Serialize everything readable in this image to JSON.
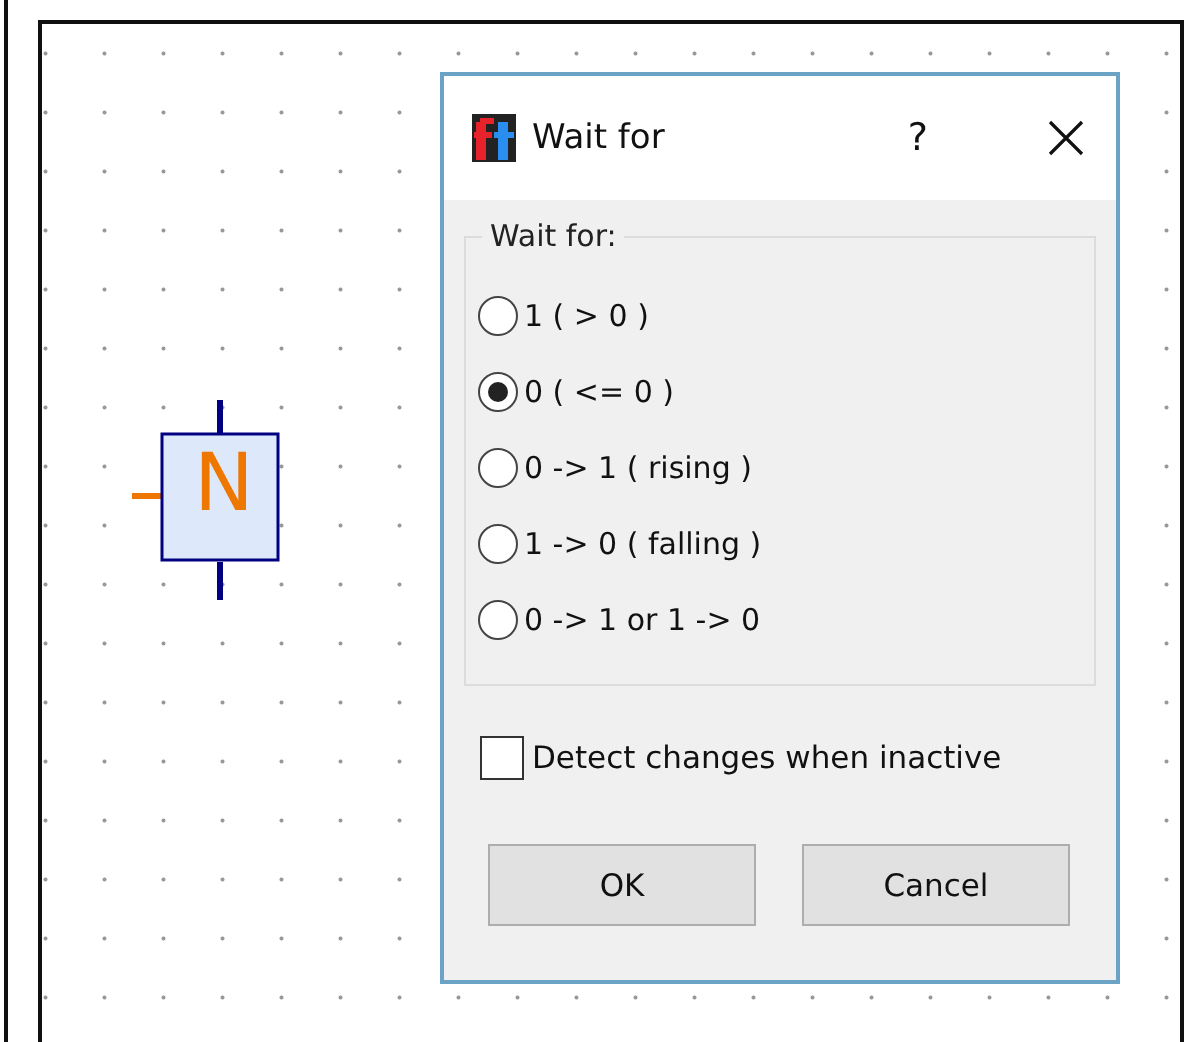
{
  "node": {
    "label": "N"
  },
  "dialog": {
    "title": "Wait for",
    "help": "?",
    "group": {
      "label": "Wait for:",
      "options": [
        {
          "label": "1 ( > 0 )",
          "selected": false
        },
        {
          "label": "0 ( <= 0 )",
          "selected": true
        },
        {
          "label": "0 -> 1 ( rising )",
          "selected": false
        },
        {
          "label": "1 -> 0 ( falling )",
          "selected": false
        },
        {
          "label": "0 -> 1 or 1 -> 0",
          "selected": false
        }
      ]
    },
    "checkbox": {
      "label": "Detect changes when inactive",
      "checked": false
    },
    "buttons": [
      "OK",
      "Cancel"
    ]
  }
}
